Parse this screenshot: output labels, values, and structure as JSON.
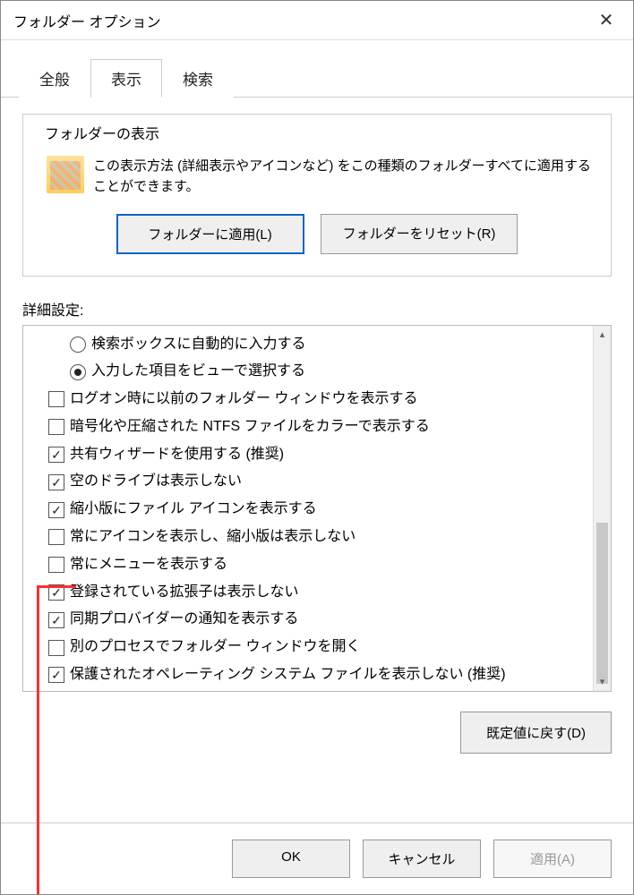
{
  "window": {
    "title": "フォルダー オプション"
  },
  "tabs": {
    "general": "全般",
    "view": "表示",
    "search": "検索",
    "active": "view"
  },
  "folderView": {
    "groupTitle": "フォルダーの表示",
    "desc": "この表示方法 (詳細表示やアイコンなど) をこの種類のフォルダーすべてに適用することができます。",
    "applyBtn": "フォルダーに適用(L)",
    "resetBtn": "フォルダーをリセット(R)"
  },
  "advanced": {
    "label": "詳細設定:",
    "items": [
      {
        "type": "radio",
        "checked": false,
        "indent": true,
        "text": "検索ボックスに自動的に入力する"
      },
      {
        "type": "radio",
        "checked": true,
        "indent": true,
        "text": "入力した項目をビューで選択する"
      },
      {
        "type": "check",
        "checked": false,
        "indent": false,
        "text": "ログオン時に以前のフォルダー ウィンドウを表示する"
      },
      {
        "type": "check",
        "checked": false,
        "indent": false,
        "text": "暗号化や圧縮された NTFS ファイルをカラーで表示する"
      },
      {
        "type": "check",
        "checked": true,
        "indent": false,
        "text": "共有ウィザードを使用する (推奨)"
      },
      {
        "type": "check",
        "checked": true,
        "indent": false,
        "text": "空のドライブは表示しない"
      },
      {
        "type": "check",
        "checked": true,
        "indent": false,
        "text": "縮小版にファイル アイコンを表示する"
      },
      {
        "type": "check",
        "checked": false,
        "indent": false,
        "text": "常にアイコンを表示し、縮小版は表示しない"
      },
      {
        "type": "check",
        "checked": false,
        "indent": false,
        "text": "常にメニューを表示する"
      },
      {
        "type": "check",
        "checked": true,
        "indent": false,
        "text": "登録されている拡張子は表示しない"
      },
      {
        "type": "check",
        "checked": true,
        "indent": false,
        "text": "同期プロバイダーの通知を表示する"
      },
      {
        "type": "check",
        "checked": false,
        "indent": false,
        "text": "別のプロセスでフォルダー ウィンドウを開く"
      },
      {
        "type": "check",
        "checked": true,
        "indent": false,
        "text": "保護されたオペレーティング システム ファイルを表示しない (推奨)"
      }
    ],
    "resetDefaults": "既定値に戻す(D)"
  },
  "footer": {
    "ok": "OK",
    "cancel": "キャンセル",
    "apply": "適用(A)"
  }
}
